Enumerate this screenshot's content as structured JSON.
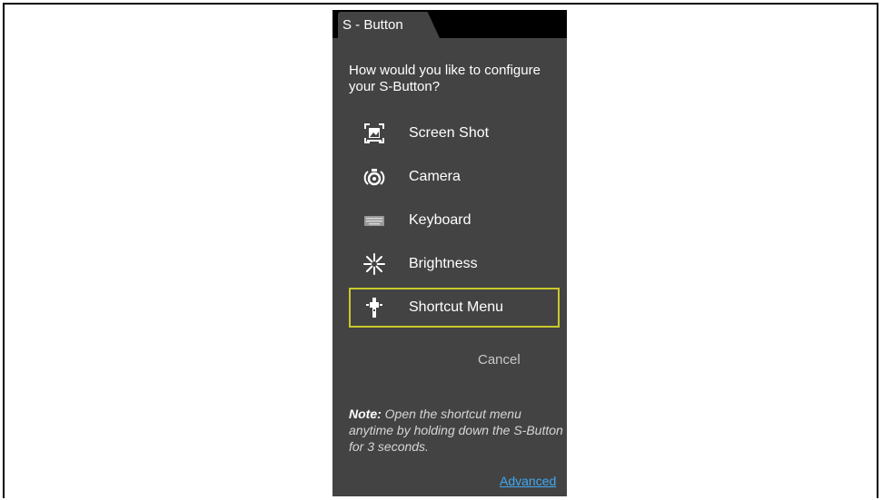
{
  "window": {
    "tab_title": "S - Button"
  },
  "dialog": {
    "question": "How would you like to configure your S-Button?",
    "options": [
      {
        "label": "Screen Shot",
        "icon": "screenshot-icon",
        "selected": false
      },
      {
        "label": "Camera",
        "icon": "camera-icon",
        "selected": false
      },
      {
        "label": "Keyboard",
        "icon": "keyboard-icon",
        "selected": false
      },
      {
        "label": "Brightness",
        "icon": "brightness-icon",
        "selected": false
      },
      {
        "label": "Shortcut Menu",
        "icon": "shortcut-menu-icon",
        "selected": true
      }
    ],
    "cancel_label": "Cancel",
    "note_prefix": "Note:",
    "note_text": "Open the shortcut menu anytime by holding down the S-Button for 3 seconds.",
    "advanced_label": "Advanced"
  },
  "colors": {
    "panel_bg": "#434343",
    "tab_strip": "#000000",
    "selection_border": "#c9c92c",
    "link": "#3fa9f5"
  }
}
